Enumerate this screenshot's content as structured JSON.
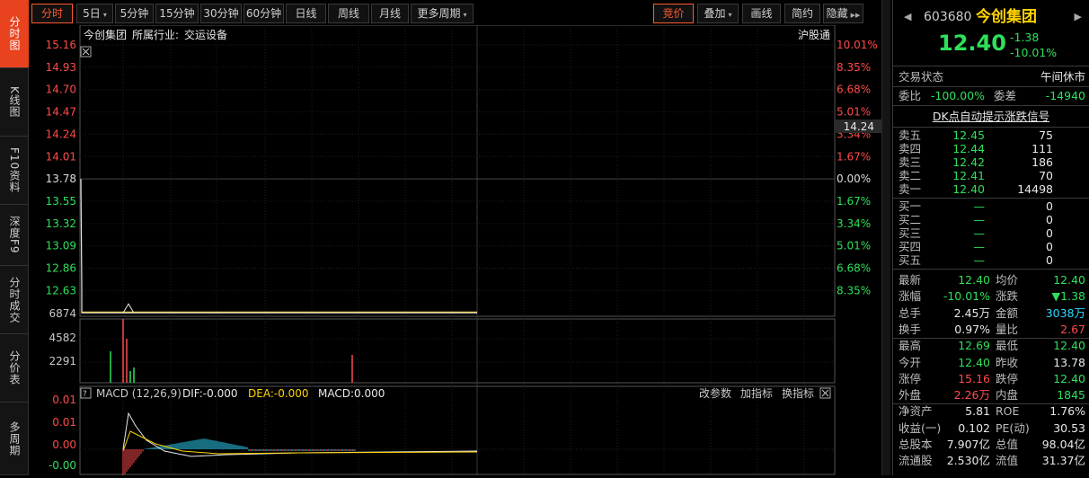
{
  "vtabs": [
    {
      "label": "分时图",
      "active": true
    },
    {
      "label": "K线图",
      "active": false
    },
    {
      "label": "F10资料",
      "active": false
    },
    {
      "label": "深度F9",
      "active": false
    },
    {
      "label": "分时成交",
      "active": false
    },
    {
      "label": "分价表",
      "active": false
    },
    {
      "label": "多周期",
      "active": false
    }
  ],
  "toolbar": {
    "periods": [
      "分时",
      "5日",
      "5分钟",
      "15分钟",
      "30分钟",
      "60分钟",
      "日线",
      "周线",
      "月线",
      "更多周期"
    ],
    "right": [
      "竞价",
      "叠加",
      "画线",
      "简约",
      "隐藏"
    ]
  },
  "chart": {
    "stock_name": "今创集团",
    "industry_label": "所属行业:",
    "industry": "交运设备",
    "exchange_link": "沪股通",
    "price_ticks": [
      "15.16",
      "14.93",
      "14.70",
      "14.47",
      "14.24",
      "14.01",
      "13.78",
      "13.55",
      "13.32",
      "13.09",
      "12.86",
      "12.63"
    ],
    "pct_ticks": [
      "10.01%",
      "8.35%",
      "6.68%",
      "5.01%",
      "3.34%",
      "1.67%",
      "0.00%",
      "1.67%",
      "3.34%",
      "5.01%",
      "6.68%",
      "8.35%"
    ],
    "cursor_price": "14.24",
    "volume_ticks": [
      "6874",
      "4582",
      "2291"
    ],
    "macd_ticks": [
      "0.01",
      "0.01",
      "0.00",
      "-0.00"
    ],
    "macd_label": "MACD (12,26,9)",
    "dif": "DIF:-0.000",
    "dea": "DEA:-0.000",
    "macd": "MACD:0.000",
    "macd_actions": [
      "改参数",
      "加指标",
      "换指标"
    ],
    "price_line_value": 12.4,
    "prev_close": 13.78
  },
  "quote": {
    "code": "603680",
    "name": "今创集团",
    "price": "12.40",
    "change": "-1.38",
    "change_pct": "-10.01%",
    "status_label": "交易状态",
    "status": "午间休市",
    "weibi_label": "委比",
    "weibi": "-100.00%",
    "weicha_label": "委差",
    "weicha": "-14940",
    "signal_link": "DK点自动提示涨跌信号",
    "asks": [
      {
        "label": "卖五",
        "price": "12.45",
        "vol": "75"
      },
      {
        "label": "卖四",
        "price": "12.44",
        "vol": "111"
      },
      {
        "label": "卖三",
        "price": "12.42",
        "vol": "186"
      },
      {
        "label": "卖二",
        "price": "12.41",
        "vol": "70"
      },
      {
        "label": "卖一",
        "price": "12.40",
        "vol": "14498"
      }
    ],
    "bids": [
      {
        "label": "买一",
        "price": "—",
        "vol": "0"
      },
      {
        "label": "买二",
        "price": "—",
        "vol": "0"
      },
      {
        "label": "买三",
        "price": "—",
        "vol": "0"
      },
      {
        "label": "买四",
        "price": "—",
        "vol": "0"
      },
      {
        "label": "买五",
        "price": "—",
        "vol": "0"
      }
    ],
    "stats": [
      [
        "最新",
        "12.40",
        "green",
        "均价",
        "12.40",
        "green"
      ],
      [
        "涨幅",
        "-10.01%",
        "green",
        "涨跌",
        "▼1.38",
        "green"
      ],
      [
        "总手",
        "2.45万",
        "white",
        "金额",
        "3038万",
        "cyan"
      ],
      [
        "换手",
        "0.97%",
        "white",
        "量比",
        "2.67",
        "red"
      ],
      [
        "最高",
        "12.69",
        "green",
        "最低",
        "12.40",
        "green"
      ],
      [
        "今开",
        "12.40",
        "green",
        "昨收",
        "13.78",
        "white"
      ],
      [
        "涨停",
        "15.16",
        "red",
        "跌停",
        "12.40",
        "green"
      ],
      [
        "外盘",
        "2.26万",
        "red",
        "内盘",
        "1845",
        "green"
      ],
      [
        "净资产",
        "5.81",
        "white",
        "ROE",
        "1.76%",
        "white"
      ],
      [
        "收益(一)",
        "0.102",
        "white",
        "PE(动)",
        "30.53",
        "white"
      ],
      [
        "总股本",
        "7.907亿",
        "white",
        "总值",
        "98.04亿",
        "white"
      ],
      [
        "流通股",
        "2.530亿",
        "white",
        "流值",
        "31.37亿",
        "white"
      ]
    ]
  }
}
